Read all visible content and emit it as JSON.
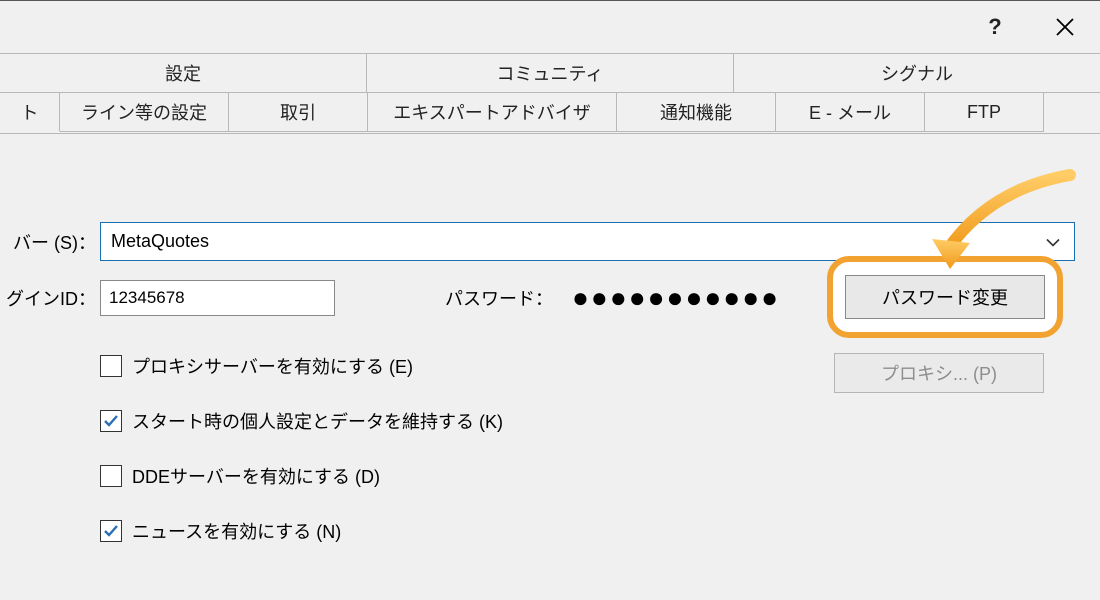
{
  "titlebar": {
    "help_glyph": "?",
    "close_label": "Close"
  },
  "tabs": {
    "row1": [
      "設定",
      "コミュニティ",
      "シグナル"
    ],
    "row2_partial_first": "ト",
    "row2": [
      "ライン等の設定",
      "取引",
      "エキスパートアドバイザ",
      "通知機能",
      "E - メール",
      "FTP"
    ]
  },
  "form": {
    "server_label": "バー (S)：",
    "server_value": "MetaQuotes",
    "login_label": "グインID：",
    "login_value": "12345678",
    "password_label": "パスワード：",
    "password_mask": "●●●●●●●●●●●",
    "change_pw_button": "パスワード変更",
    "proxy_button": "プロキシ... (P)",
    "checkboxes": [
      {
        "label": "プロキシサーバーを有効にする (E)",
        "checked": false
      },
      {
        "label": "スタート時の個人設定とデータを維持する (K)",
        "checked": true
      },
      {
        "label": "DDEサーバーを有効にする (D)",
        "checked": false
      },
      {
        "label": "ニュースを有効にする (N)",
        "checked": true
      }
    ]
  }
}
